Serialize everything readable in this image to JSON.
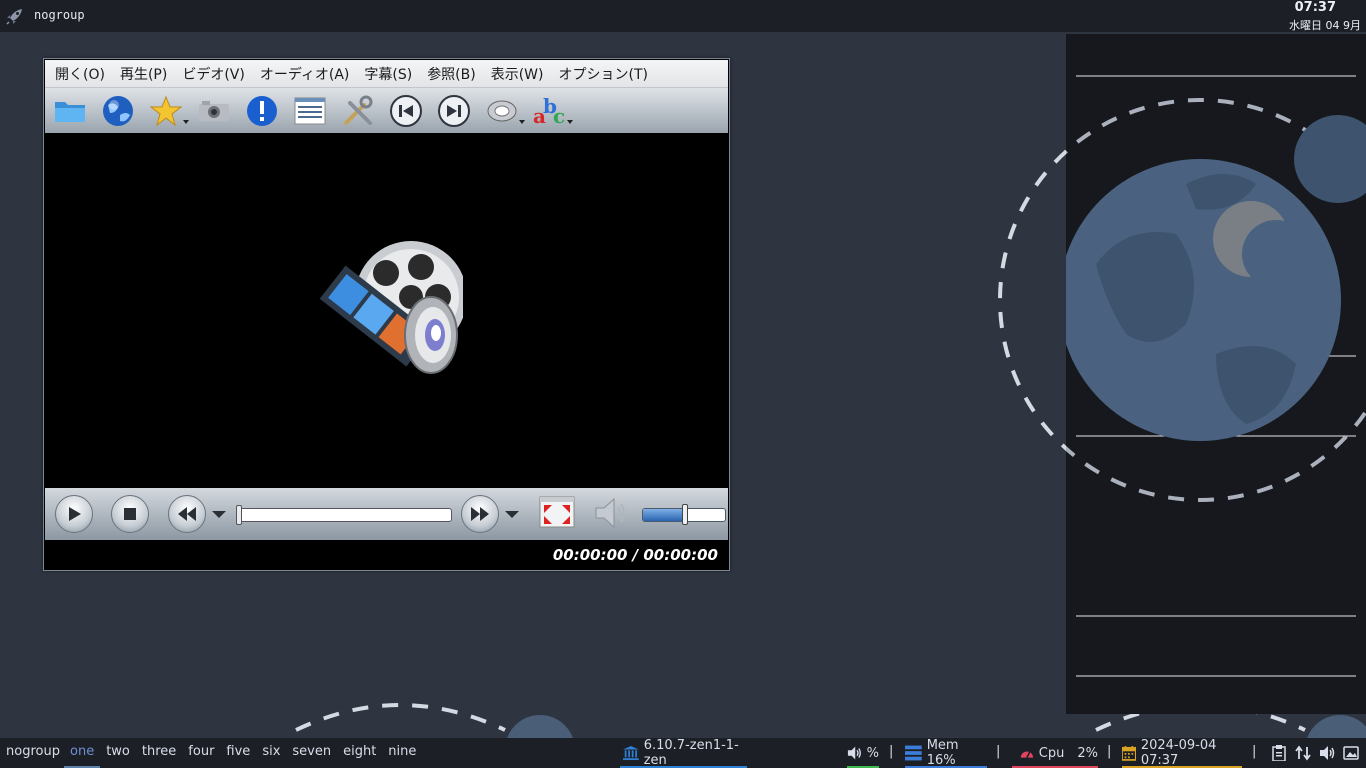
{
  "topbar": {
    "workspace_name": "nogroup",
    "clock_time": "07:37",
    "clock_date": "水曜日 04 9月"
  },
  "player": {
    "menu": [
      "開く(O)",
      "再生(P)",
      "ビデオ(V)",
      "オーディオ(A)",
      "字幕(S)",
      "参照(B)",
      "表示(W)",
      "オプション(T)"
    ],
    "toolbar_icons": [
      "folder-icon",
      "globe-icon",
      "favorites-star-icon",
      "screenshot-camera-icon",
      "info-icon",
      "playlist-icon",
      "preferences-tools-icon",
      "previous-track-icon",
      "next-track-icon",
      "audio-track-icon",
      "subtitles-abc-icon"
    ],
    "time_display": "00:00:00 / 00:00:00",
    "seek_position": 0,
    "volume_level": 0.52
  },
  "bottombar": {
    "group_label": "nogroup",
    "workspaces": [
      {
        "label": "one",
        "active": true
      },
      {
        "label": "two",
        "active": false
      },
      {
        "label": "three",
        "active": false
      },
      {
        "label": "four",
        "active": false
      },
      {
        "label": "five",
        "active": false
      },
      {
        "label": "six",
        "active": false
      },
      {
        "label": "seven",
        "active": false
      },
      {
        "label": "eight",
        "active": false
      },
      {
        "label": "nine",
        "active": false
      }
    ],
    "kernel": "6.10.7-zen1-1-zen",
    "volume_text": "%",
    "mem_text": "Mem 16%",
    "cpu_text": "Cpu",
    "cpu_value": "2%",
    "datetime": "2024-09-04 07:37",
    "separator": "|",
    "colors": {
      "kernel": "#2f81d6",
      "volume": "#3fb950",
      "mem": "#3b7dd8",
      "cpu": "#e0455e",
      "date": "#d9a424"
    }
  }
}
